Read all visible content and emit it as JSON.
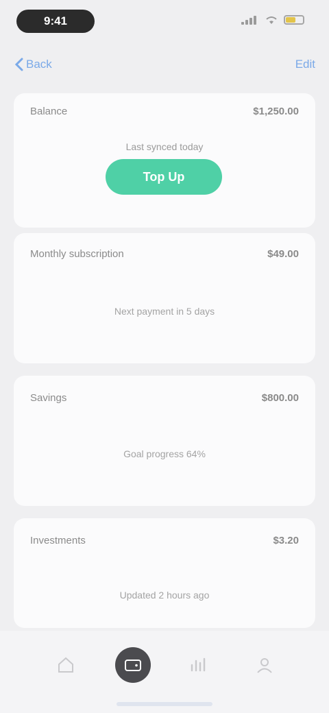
{
  "status_bar": {
    "time": "9:41"
  },
  "nav": {
    "back_label": "Back",
    "action_label": "Edit"
  },
  "summary_card": {
    "label": "Balance",
    "value": "$1,250.00",
    "caption": "Last synced today",
    "button_label": "Top Up"
  },
  "cards": [
    {
      "label": "Monthly subscription",
      "value": "$49.00",
      "sub": "Next payment in 5 days"
    },
    {
      "label": "Savings",
      "value": "$800.00",
      "sub": "Goal progress 64%"
    },
    {
      "label": "Investments",
      "value": "$3.20",
      "sub": "Updated 2 hours ago"
    }
  ],
  "tabs": [
    {
      "name": "home",
      "icon": "home-icon"
    },
    {
      "name": "wallet",
      "icon": "wallet-icon",
      "active": true
    },
    {
      "name": "stats",
      "icon": "chart-icon"
    },
    {
      "name": "profile",
      "icon": "person-icon"
    }
  ],
  "colors": {
    "accent": "#4fd0a6",
    "link": "#7aa9e8",
    "background": "#efeff1"
  }
}
